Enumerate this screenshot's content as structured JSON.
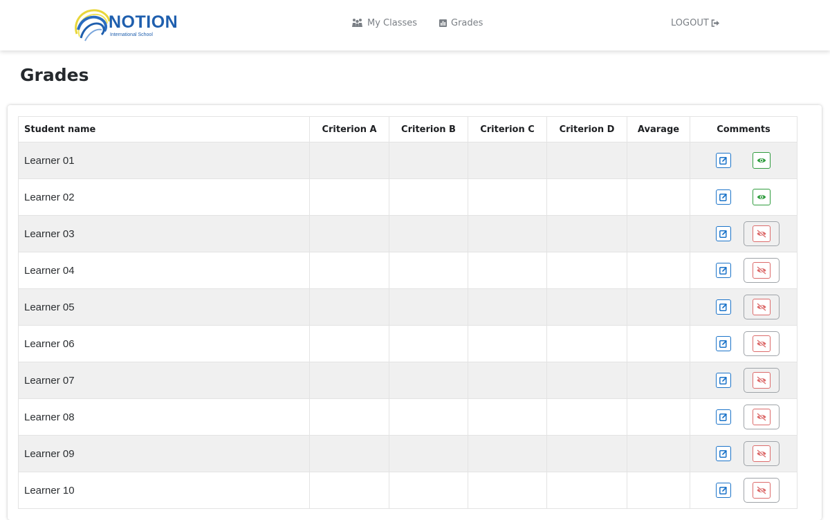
{
  "brand": {
    "name": "NOTION",
    "subtitle": "International School"
  },
  "nav": {
    "my_classes": "My Classes",
    "grades": "Grades",
    "logout": "LOGOUT"
  },
  "page": {
    "title": "Grades"
  },
  "table": {
    "headers": {
      "student_name": "Student name",
      "criterion_a": "Criterion A",
      "criterion_b": "Criterion B",
      "criterion_c": "Criterion C",
      "criterion_d": "Criterion D",
      "average": "Avarage",
      "comments": "Comments"
    },
    "rows": [
      {
        "name": "Learner 01",
        "comment_visible": true
      },
      {
        "name": "Learner 02",
        "comment_visible": true
      },
      {
        "name": "Learner 03",
        "comment_visible": false
      },
      {
        "name": "Learner 04",
        "comment_visible": false
      },
      {
        "name": "Learner 05",
        "comment_visible": false
      },
      {
        "name": "Learner 06",
        "comment_visible": false
      },
      {
        "name": "Learner 07",
        "comment_visible": false
      },
      {
        "name": "Learner 08",
        "comment_visible": false
      },
      {
        "name": "Learner 09",
        "comment_visible": false
      },
      {
        "name": "Learner 10",
        "comment_visible": false
      }
    ]
  },
  "colors": {
    "brand_blue": "#1f5fae",
    "edit_blue": "#1a73c9",
    "view_green": "#2e9b3c",
    "hidden_red": "#dc6a6a",
    "row_stripe": "#f0f0f0"
  },
  "icons": {
    "nav_classes": "users-icon",
    "nav_grades": "chart-icon",
    "nav_logout": "logout-icon",
    "edit": "edit-icon",
    "view": "eye-icon",
    "hidden": "eye-slash-icon"
  }
}
